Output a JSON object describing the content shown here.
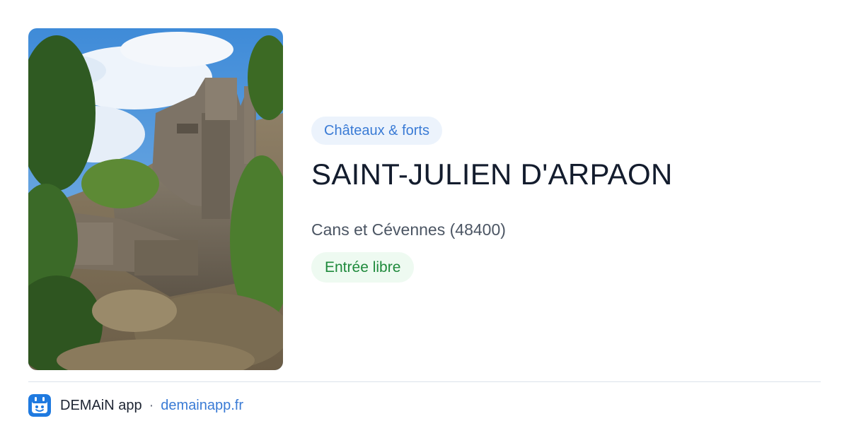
{
  "card": {
    "image": {
      "alt_icon": "castle-photo",
      "subject": "ruined castle on rocky hillside"
    },
    "category": "Châteaux & forts",
    "title": "SAINT-JULIEN D'ARPAON",
    "location": "Cans et Cévennes (48400)",
    "access": "Entrée libre"
  },
  "footer": {
    "app_name": "DEMAiN app",
    "separator": "·",
    "site": "demainapp.fr"
  },
  "colors": {
    "category_text": "#3a7bd5",
    "category_bg": "#ecf3fc",
    "access_text": "#1f8a3c",
    "access_bg": "#eefaf1",
    "title": "#131c2d",
    "link": "#3a7bd5"
  }
}
